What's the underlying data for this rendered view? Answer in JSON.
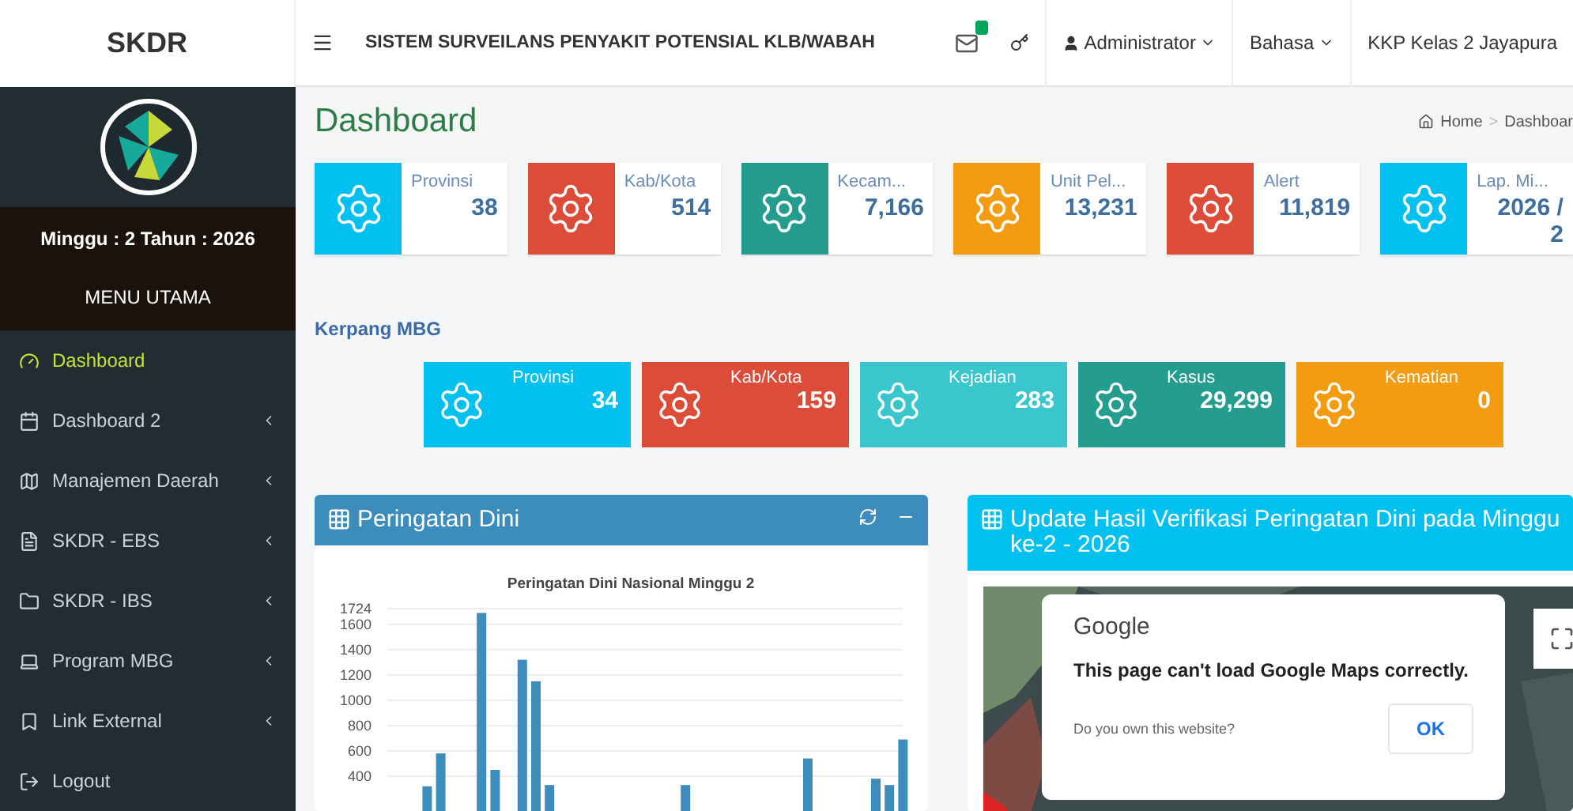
{
  "brand": "SKDR",
  "topbar": {
    "title": "SISTEM SURVEILANS PENYAKIT POTENSIAL KLB/WABAH",
    "user": "Administrator",
    "language": "Bahasa",
    "office": "KKP Kelas 2 Jayapura"
  },
  "sidebar": {
    "period": "Minggu : 2 Tahun : 2026",
    "menu_title": "MENU UTAMA",
    "items": [
      {
        "label": "Dashboard",
        "selected": true,
        "submenu": false
      },
      {
        "label": "Dashboard 2",
        "selected": false,
        "submenu": true
      },
      {
        "label": "Manajemen Daerah",
        "selected": false,
        "submenu": true
      },
      {
        "label": "SKDR - EBS",
        "selected": false,
        "submenu": true
      },
      {
        "label": "SKDR - IBS",
        "selected": false,
        "submenu": true
      },
      {
        "label": "Program MBG",
        "selected": false,
        "submenu": true
      },
      {
        "label": "Link External",
        "selected": false,
        "submenu": true
      },
      {
        "label": "Logout",
        "selected": false,
        "submenu": false
      }
    ]
  },
  "page": {
    "title": "Dashboard",
    "breadcrumb": [
      "Home",
      "Dashboar"
    ],
    "breadcrumb_separator": ">"
  },
  "stats": [
    {
      "label": "Provinsi",
      "value": "38",
      "color": "#00c0ef"
    },
    {
      "label": "Kab/Kota",
      "value": "514",
      "color": "#dd4b39"
    },
    {
      "label": "Kecam...",
      "value": "7,166",
      "color": "#249d8e"
    },
    {
      "label": "Unit Pel...",
      "value": "13,231",
      "color": "#f39c12"
    },
    {
      "label": "Alert",
      "value": "11,819",
      "color": "#dd4b39"
    },
    {
      "label": "Lap. Mi...",
      "value": "2026 / 2",
      "color": "#00c0ef"
    }
  ],
  "mbg": {
    "title": "Kerpang MBG",
    "stats": [
      {
        "label": "Provinsi",
        "value": "34",
        "color": "#00c0ef"
      },
      {
        "label": "Kab/Kota",
        "value": "159",
        "color": "#dd4b39"
      },
      {
        "label": "Kejadian",
        "value": "283",
        "color": "#39c6cc"
      },
      {
        "label": "Kasus",
        "value": "29,299",
        "color": "#249d8e"
      },
      {
        "label": "Kematian",
        "value": "0",
        "color": "#f39c12"
      }
    ]
  },
  "warning_panel": {
    "title": "Peringatan Dini",
    "chart_data": {
      "type": "bar",
      "title": "Peringatan Dini Nasional Minggu 2",
      "ylim": [
        0,
        1724
      ],
      "yticks": [
        400,
        600,
        800,
        1000,
        1200,
        1400,
        1600,
        1724
      ],
      "grid": true,
      "series": [
        {
          "color": "#3c8dbc",
          "values": [
            0,
            0,
            320,
            580,
            0,
            0,
            1690,
            450,
            0,
            1320,
            1150,
            330,
            0,
            0,
            0,
            0,
            0,
            0,
            0,
            0,
            0,
            330,
            0,
            0,
            0,
            0,
            0,
            0,
            0,
            0,
            540,
            0,
            0,
            0,
            0,
            380,
            330,
            690
          ]
        }
      ]
    }
  },
  "map_panel": {
    "title": "Update Hasil Verifikasi Peringatan Dini pada Minggu ke-2 - 2026",
    "dialog": {
      "brand": "Google",
      "message": "This page can't load Google Maps correctly.",
      "question": "Do you own this website?",
      "button": "OK"
    }
  }
}
